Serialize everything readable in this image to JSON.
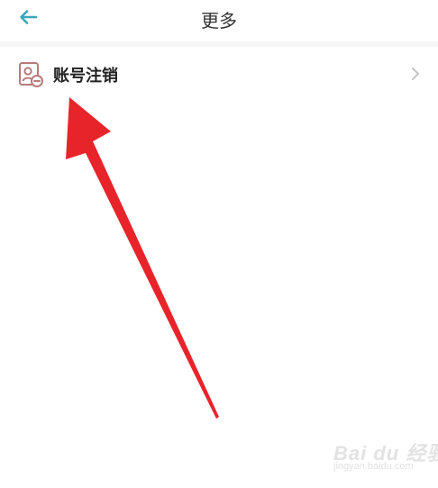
{
  "header": {
    "title": "更多",
    "back_icon": "arrow-left-icon"
  },
  "menu": {
    "items": [
      {
        "label": "账号注销",
        "icon": "account-cancel-icon",
        "trailing_icon": "chevron-right-icon"
      }
    ]
  },
  "annotation": {
    "arrow_color": "#e8242b"
  },
  "watermark": {
    "brand": "Bai du 经验",
    "url": "jingyan.baidu.com"
  },
  "colors": {
    "back_icon": "#3aa6b9",
    "item_icon": "#b77a7a",
    "chevron": "#c4c4c4",
    "divider": "#f6f6f7"
  }
}
